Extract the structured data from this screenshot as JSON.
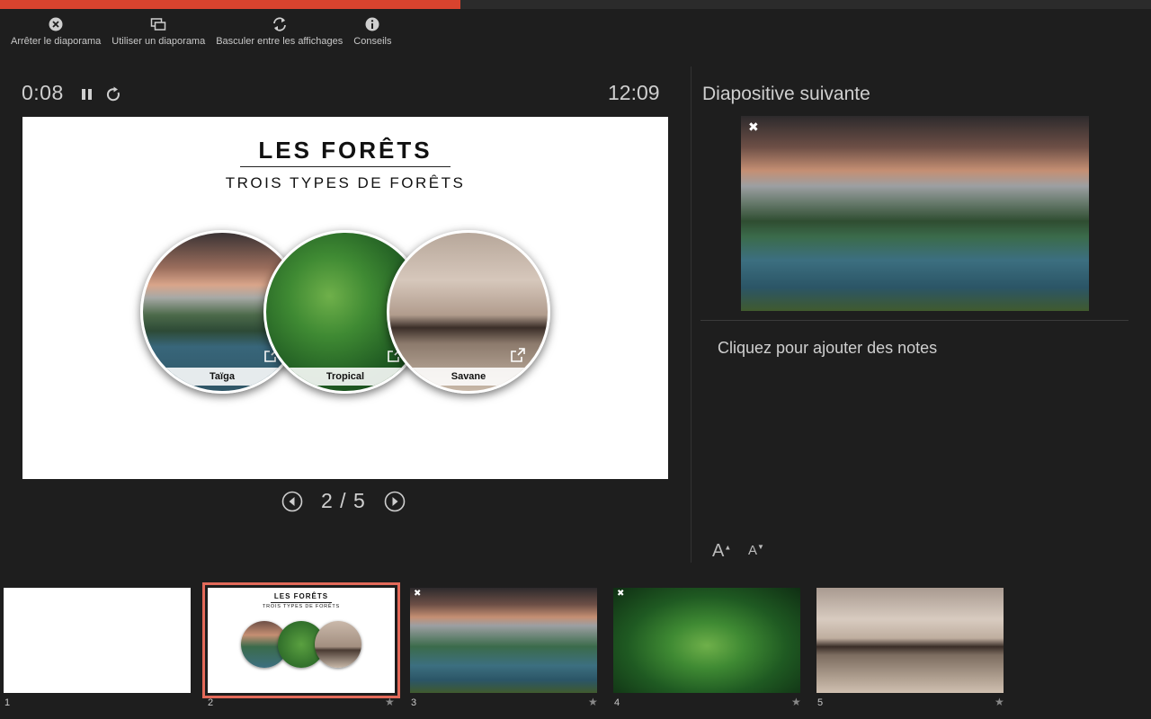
{
  "progress": {
    "fraction": 0.4
  },
  "toolbar": {
    "items": [
      {
        "label": "Arrêter le diaporama",
        "icon": "close-circle-icon"
      },
      {
        "label": "Utiliser un diaporama",
        "icon": "screens-icon"
      },
      {
        "label": "Basculer entre les affichages",
        "icon": "swap-icon"
      },
      {
        "label": "Conseils",
        "icon": "info-icon"
      }
    ]
  },
  "presenter": {
    "elapsed": "0:08",
    "clock": "12:09",
    "page_indicator": "2 / 5"
  },
  "current_slide": {
    "title": "LES FORÊTS",
    "subtitle": "TROIS TYPES DE FORÊTS",
    "circles": [
      {
        "label": "Taïga"
      },
      {
        "label": "Tropical"
      },
      {
        "label": "Savane"
      }
    ]
  },
  "next_slide": {
    "heading": "Diapositive suivante",
    "marker": "✖"
  },
  "notes": {
    "placeholder": "Cliquez pour ajouter des notes"
  },
  "font_controls": {
    "increase_label": "A",
    "decrease_label": "A"
  },
  "thumbnails": [
    {
      "number": "1",
      "selected": false,
      "has_x": false,
      "has_star": false
    },
    {
      "number": "2",
      "selected": true,
      "has_x": false,
      "has_star": true
    },
    {
      "number": "3",
      "selected": false,
      "has_x": true,
      "has_star": true
    },
    {
      "number": "4",
      "selected": false,
      "has_x": true,
      "has_star": true
    },
    {
      "number": "5",
      "selected": false,
      "has_x": false,
      "has_star": true
    }
  ],
  "thumb_mini": {
    "title": "LES FORÊTS",
    "subtitle": "TROIS TYPES DE FORÊTS"
  },
  "glyphs": {
    "star": "★",
    "x": "✖"
  },
  "colors": {
    "progress": "#d9432e",
    "selected_outline": "#e36a5a",
    "background": "#1e1e1e"
  }
}
